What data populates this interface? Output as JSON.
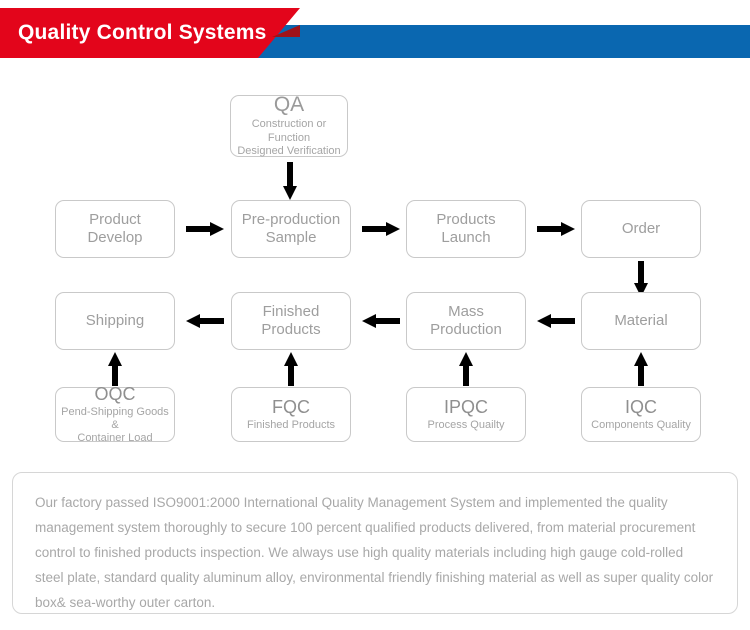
{
  "header": {
    "title": "Quality Control Systems",
    "red_color": "#E3051B",
    "blue_color": "#0A67B0",
    "title_color": "#FFFFFF"
  },
  "flowchart": {
    "qa_box": {
      "code": "QA",
      "sub_line1": "Construction or Function",
      "sub_line2": "Designed Verification"
    },
    "row1": [
      {
        "line1": "Product",
        "line2": "Develop"
      },
      {
        "line1": "Pre-production",
        "line2": "Sample"
      },
      {
        "line1": "Products",
        "line2": "Launch"
      },
      {
        "line1": "Order",
        "line2": ""
      }
    ],
    "row2": [
      {
        "line1": "Shipping",
        "line2": ""
      },
      {
        "line1": "Finished",
        "line2": "Products"
      },
      {
        "line1": "Mass",
        "line2": "Production"
      },
      {
        "line1": "Material",
        "line2": ""
      }
    ],
    "qc_row": [
      {
        "code": "OQC",
        "sub_line1": "Pend-Shipping Goods &",
        "sub_line2": "Container Load"
      },
      {
        "code": "FQC",
        "sub_line1": "Finished Products",
        "sub_line2": ""
      },
      {
        "code": "IPQC",
        "sub_line1": "Process Quailty",
        "sub_line2": ""
      },
      {
        "code": "IQC",
        "sub_line1": "Components Quality",
        "sub_line2": ""
      }
    ],
    "box_border_color": "#C9C9C9",
    "box_text_color": "#9E9E9E",
    "arrow_color": "#000000"
  },
  "description": {
    "text": "Our factory passed ISO9001:2000 International Quality Management System and  implemented the quality management system thoroughly to secure 100 percent qualified products delivered, from material procurement control to finished products inspection. We always use high quality materials including high gauge cold-rolled steel plate, standard quality aluminum alloy, environmental friendly finishing material as well as super quality color box& sea-worthy outer carton.",
    "text_color": "#A8A8A8",
    "border_color": "#D6D6D6"
  }
}
